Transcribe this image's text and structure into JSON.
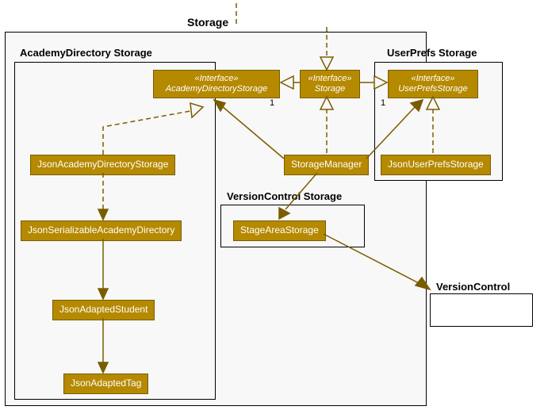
{
  "outer": {
    "label": "Storage"
  },
  "academy": {
    "label": "AcademyDirectory Storage",
    "interface": {
      "stereo": "«Interface»",
      "name": "AcademyDirectoryStorage"
    },
    "jsonStorage": "JsonAcademyDirectoryStorage",
    "jsonSerializable": "JsonSerializableAcademyDirectory",
    "jsonStudent": "JsonAdaptedStudent",
    "jsonTag": "JsonAdaptedTag"
  },
  "storageIf": {
    "stereo": "«Interface»",
    "name": "Storage"
  },
  "storageManager": "StorageManager",
  "userprefs": {
    "label": "UserPrefs Storage",
    "interface": {
      "stereo": "«Interface»",
      "name": "UserPrefsStorage"
    },
    "jsonStorage": "JsonUserPrefsStorage"
  },
  "version": {
    "label": "VersionControl Storage",
    "stageArea": "StageAreaStorage"
  },
  "versionControl": "VersionControl",
  "mult": {
    "one": "1",
    "star": "*"
  }
}
